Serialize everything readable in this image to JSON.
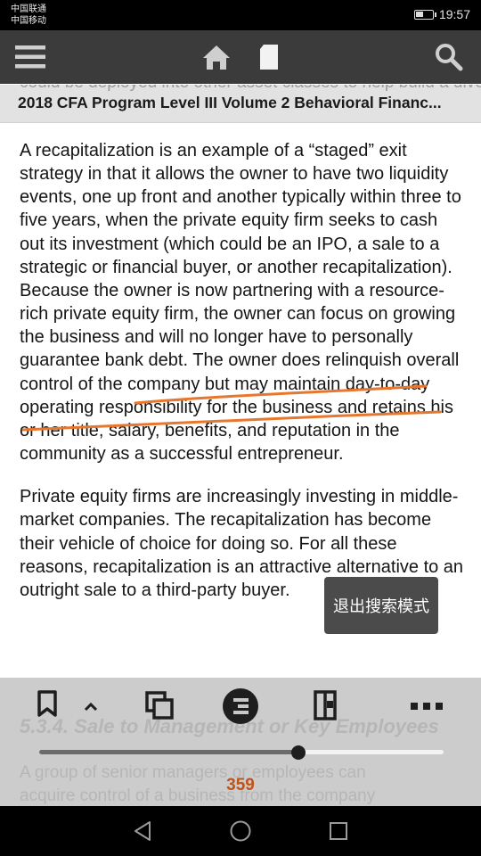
{
  "status_bar": {
    "carrier_1": "中国联通",
    "carrier_2": "中国移动",
    "time": "19:57",
    "battery_level": 0.45
  },
  "toolbar": {
    "menu_icon": "hamburger-menu-icon",
    "home_icon": "home-icon",
    "bookmark_icon": "document-icon",
    "search_icon": "search-icon"
  },
  "header": {
    "background_text": "could be deployed into other asset classes to help build a diversified portfolio.",
    "title": "2018 CFA Program Level III Volume 2 Behavioral Financ..."
  },
  "content": {
    "paragraph_1": "A recapitalization is an example of a “staged” exit strategy in that it allows the owner to have two liquidity events, one up front and another typically within three to five years, when the private equity firm seeks to cash out its investment (which could be an IPO, a sale to a strategic or financial buyer, or another recapitalization). Because the owner is now partnering with a resource-rich private equity firm, the owner can focus on growing the business and will no longer have to personally guarantee bank debt. The owner does relinquish overall control of the company but may maintain day-to-day operating responsibility for the business and retains his or her title, salary, benefits, and reputation in the community as a successful entrepreneur.",
    "paragraph_2": "Private equity firms are increasingly investing in middle-market companies. The recapitalization has become their vehicle of choice for doing so. For all these reasons, recapitalization is an attractive alternative to an outright sale to a third-party buyer.",
    "annotation_color": "#e8772e"
  },
  "toast": {
    "label": "退出搜索模式"
  },
  "reader_panel": {
    "behind_heading": "5.3.4. Sale to Management or Key Employees",
    "behind_line_1": "A group of senior managers or employees can",
    "behind_line_2": "acquire control of a business from the company",
    "icons": [
      "bookmark-icon",
      "chevron-up-icon",
      "copy-pages-icon",
      "table-of-contents-icon",
      "page-layout-icon",
      "more-icon"
    ],
    "progress": 0.64,
    "page_number": "359",
    "page_number_color": "#c0531a"
  },
  "nav_bar": {
    "icons": [
      "back-icon",
      "home-circle-icon",
      "recents-icon"
    ]
  }
}
